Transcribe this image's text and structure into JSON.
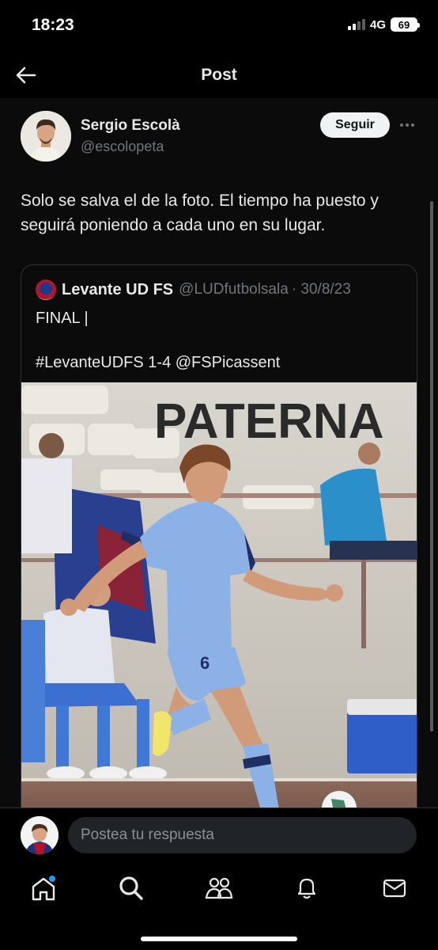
{
  "status_bar": {
    "time": "18:23",
    "network": "4G",
    "battery": "69"
  },
  "header": {
    "title": "Post"
  },
  "post": {
    "author_name": "Sergio Escolà",
    "author_handle": "@escolopeta",
    "follow_label": "Seguir",
    "text": "Solo se salva el de la foto. El tiempo ha puesto y seguirá poniendo a cada uno en su lugar."
  },
  "quoted_post": {
    "author_name": "Levante UD FS",
    "author_handle": "@LUDfutbolsala",
    "date": "· 30/8/23",
    "line1": "FINAL |",
    "line2": "#LevanteUDFS 1-4 @FSPicassent"
  },
  "photo": {
    "banner_text": "PATERNA",
    "jersey_number": "6"
  },
  "reply": {
    "placeholder": "Postea tu respuesta"
  },
  "tab_bar": [
    "home-icon",
    "search-icon",
    "communities-icon",
    "notifications-icon",
    "messages-icon"
  ],
  "colors": {
    "background": "#000000",
    "text": "#e7e9ea",
    "muted": "#71767b",
    "accent": "#1d9bf0"
  }
}
